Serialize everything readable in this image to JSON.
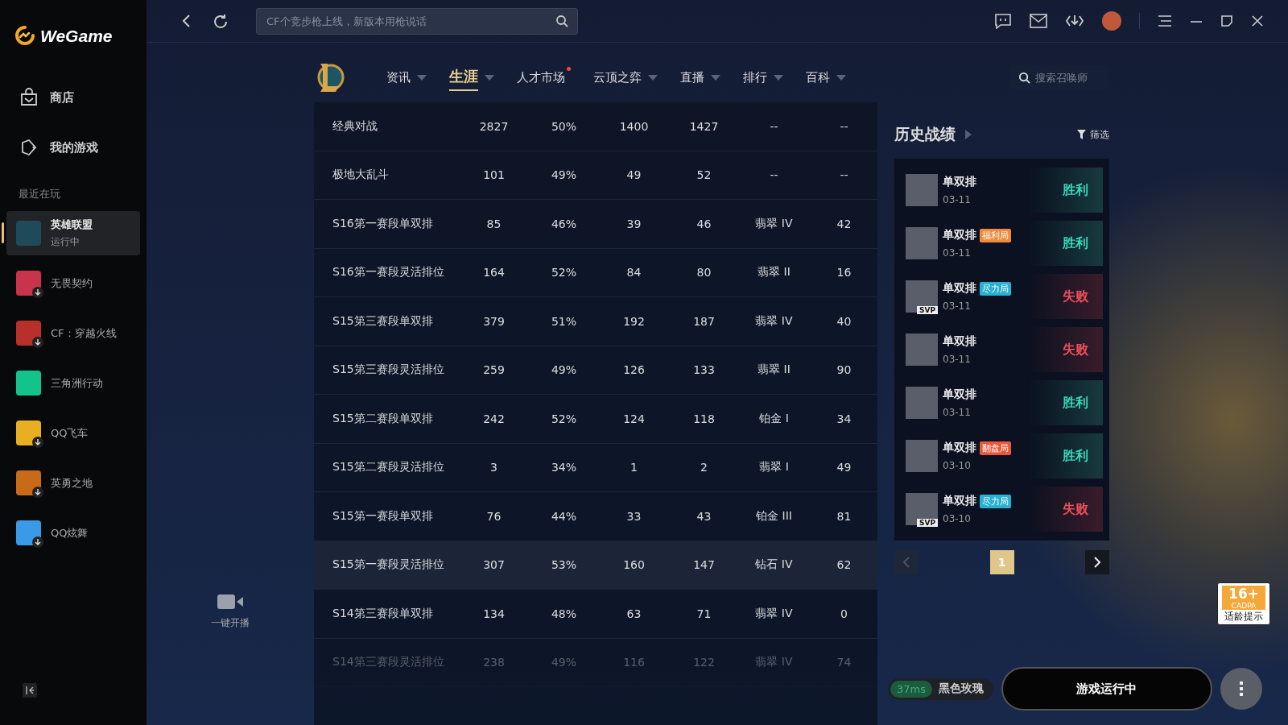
{
  "brand": {
    "name": "WeGame"
  },
  "sidebar": {
    "nav": [
      {
        "label": "商店",
        "kind": "store"
      },
      {
        "label": "我的游戏",
        "kind": "games"
      }
    ],
    "section_title": "最近在玩",
    "games": [
      {
        "name": "英雄联盟",
        "status": "运行中",
        "selected": true,
        "downloadable": false,
        "color": "#1e4a5a"
      },
      {
        "name": "无畏契约",
        "selected": false,
        "downloadable": true,
        "color": "#c8344c"
      },
      {
        "name": "CF：穿越火线",
        "selected": false,
        "downloadable": true,
        "color": "#b8302a"
      },
      {
        "name": "三角洲行动",
        "selected": false,
        "downloadable": false,
        "color": "#12c48c"
      },
      {
        "name": "QQ飞车",
        "selected": false,
        "downloadable": true,
        "color": "#e8b020"
      },
      {
        "name": "英勇之地",
        "selected": false,
        "downloadable": true,
        "color": "#c86a18"
      },
      {
        "name": "QQ炫舞",
        "selected": false,
        "downloadable": true,
        "color": "#3a9ae8"
      }
    ]
  },
  "topbar": {
    "search": {
      "placeholder": "CF个竞步枪上线，新版本用枪说话"
    }
  },
  "game_nav": {
    "items": [
      {
        "label": "资讯",
        "selected": false,
        "dropdown": true,
        "new": false
      },
      {
        "label": "生涯",
        "selected": true,
        "dropdown": true,
        "new": false
      },
      {
        "label": "人才市场",
        "selected": false,
        "dropdown": false,
        "new": true
      },
      {
        "label": "云顶之弈",
        "selected": false,
        "dropdown": true,
        "new": false
      },
      {
        "label": "直播",
        "selected": false,
        "dropdown": true,
        "new": false
      },
      {
        "label": "排行",
        "selected": false,
        "dropdown": true,
        "new": false
      },
      {
        "label": "百科",
        "selected": false,
        "dropdown": true,
        "new": false
      }
    ],
    "search": {
      "placeholder": "搜索召唤师"
    }
  },
  "live_button": {
    "label": "一键开播"
  },
  "table": {
    "rows": [
      {
        "cells": [
          "经典对战",
          "2827",
          "50%",
          "1400",
          "1427",
          "--",
          "--"
        ],
        "highlighted": false,
        "faded": false
      },
      {
        "cells": [
          "极地大乱斗",
          "101",
          "49%",
          "49",
          "52",
          "--",
          "--"
        ],
        "highlighted": false,
        "faded": false
      },
      {
        "cells": [
          "S16第一赛段单双排",
          "85",
          "46%",
          "39",
          "46",
          "翡翠 IV",
          "42"
        ],
        "highlighted": false,
        "faded": false
      },
      {
        "cells": [
          "S16第一赛段灵活排位",
          "164",
          "52%",
          "84",
          "80",
          "翡翠 II",
          "16"
        ],
        "highlighted": false,
        "faded": false
      },
      {
        "cells": [
          "S15第三赛段单双排",
          "379",
          "51%",
          "192",
          "187",
          "翡翠 IV",
          "40"
        ],
        "highlighted": false,
        "faded": false
      },
      {
        "cells": [
          "S15第三赛段灵活排位",
          "259",
          "49%",
          "126",
          "133",
          "翡翠 II",
          "90"
        ],
        "highlighted": false,
        "faded": false
      },
      {
        "cells": [
          "S15第二赛段单双排",
          "242",
          "52%",
          "124",
          "118",
          "铂金 I",
          "34"
        ],
        "highlighted": false,
        "faded": false
      },
      {
        "cells": [
          "S15第二赛段灵活排位",
          "3",
          "34%",
          "1",
          "2",
          "翡翠 I",
          "49"
        ],
        "highlighted": false,
        "faded": false
      },
      {
        "cells": [
          "S15第一赛段单双排",
          "76",
          "44%",
          "33",
          "43",
          "铂金 III",
          "81"
        ],
        "highlighted": false,
        "faded": false
      },
      {
        "cells": [
          "S15第一赛段灵活排位",
          "307",
          "53%",
          "160",
          "147",
          "钻石 IV",
          "62"
        ],
        "highlighted": true,
        "faded": false
      },
      {
        "cells": [
          "S14第三赛段单双排",
          "134",
          "48%",
          "63",
          "71",
          "翡翠 IV",
          "0"
        ],
        "highlighted": false,
        "faded": false
      },
      {
        "cells": [
          "S14第三赛段灵活排位",
          "238",
          "49%",
          "116",
          "122",
          "翡翠 IV",
          "74"
        ],
        "highlighted": false,
        "faded": true
      }
    ]
  },
  "history": {
    "title": "历史战绩",
    "filter": "筛选",
    "matches": [
      {
        "mode": "单双排",
        "date": "03-11",
        "result": "胜利",
        "kind": "win"
      },
      {
        "mode": "单双排",
        "tag": {
          "label": "福利局",
          "color": "#f08a3c"
        },
        "date": "03-11",
        "result": "胜利",
        "kind": "win"
      },
      {
        "mode": "单双排",
        "tag": {
          "label": "尽力局",
          "color": "#2ab0d0"
        },
        "badge": "SVP",
        "date": "03-11",
        "result": "失败",
        "kind": "loss"
      },
      {
        "mode": "单双排",
        "date": "03-11",
        "result": "失败",
        "kind": "loss"
      },
      {
        "mode": "单双排",
        "date": "03-11",
        "result": "胜利",
        "kind": "win"
      },
      {
        "mode": "单双排",
        "tag": {
          "label": "翻盘局",
          "color": "#e8583c"
        },
        "date": "03-10",
        "result": "胜利",
        "kind": "win"
      },
      {
        "mode": "单双排",
        "tag": {
          "label": "尽力局",
          "color": "#2ab0d0"
        },
        "badge": "SVP",
        "date": "03-10",
        "result": "失败",
        "kind": "loss"
      }
    ],
    "pagination": {
      "prev_disabled": true,
      "pages": [
        {
          "label": "1",
          "selected": true
        }
      ],
      "next_disabled": false
    }
  },
  "age_rating": {
    "age": "16+",
    "org": "CADPA",
    "caption": "适龄提示"
  },
  "footer": {
    "ping": "37ms",
    "server": "黑色玫瑰",
    "play_button": "游戏运行中"
  }
}
